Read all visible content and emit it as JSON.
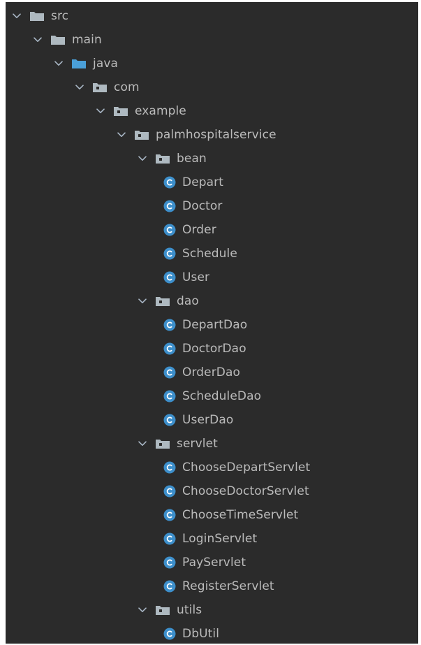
{
  "tree": {
    "nodes": [
      {
        "label": "src",
        "depth": 0,
        "kind": "folder",
        "expanded": true
      },
      {
        "label": "main",
        "depth": 1,
        "kind": "folder",
        "expanded": true
      },
      {
        "label": "java",
        "depth": 2,
        "kind": "source-root",
        "expanded": true
      },
      {
        "label": "com",
        "depth": 3,
        "kind": "package",
        "expanded": true
      },
      {
        "label": "example",
        "depth": 4,
        "kind": "package",
        "expanded": true
      },
      {
        "label": "palmhospitalservice",
        "depth": 5,
        "kind": "package",
        "expanded": true
      },
      {
        "label": "bean",
        "depth": 6,
        "kind": "package",
        "expanded": true
      },
      {
        "label": "Depart",
        "depth": 7,
        "kind": "class"
      },
      {
        "label": "Doctor",
        "depth": 7,
        "kind": "class"
      },
      {
        "label": "Order",
        "depth": 7,
        "kind": "class"
      },
      {
        "label": "Schedule",
        "depth": 7,
        "kind": "class"
      },
      {
        "label": "User",
        "depth": 7,
        "kind": "class"
      },
      {
        "label": "dao",
        "depth": 6,
        "kind": "package",
        "expanded": true
      },
      {
        "label": "DepartDao",
        "depth": 7,
        "kind": "class"
      },
      {
        "label": "DoctorDao",
        "depth": 7,
        "kind": "class"
      },
      {
        "label": "OrderDao",
        "depth": 7,
        "kind": "class"
      },
      {
        "label": "ScheduleDao",
        "depth": 7,
        "kind": "class"
      },
      {
        "label": "UserDao",
        "depth": 7,
        "kind": "class"
      },
      {
        "label": "servlet",
        "depth": 6,
        "kind": "package",
        "expanded": true
      },
      {
        "label": "ChooseDepartServlet",
        "depth": 7,
        "kind": "class"
      },
      {
        "label": "ChooseDoctorServlet",
        "depth": 7,
        "kind": "class"
      },
      {
        "label": "ChooseTimeServlet",
        "depth": 7,
        "kind": "class"
      },
      {
        "label": "LoginServlet",
        "depth": 7,
        "kind": "class"
      },
      {
        "label": "PayServlet",
        "depth": 7,
        "kind": "class"
      },
      {
        "label": "RegisterServlet",
        "depth": 7,
        "kind": "class"
      },
      {
        "label": "utils",
        "depth": 6,
        "kind": "package",
        "expanded": true
      },
      {
        "label": "DbUtil",
        "depth": 7,
        "kind": "class"
      }
    ]
  },
  "colors": {
    "background": "#2b2b2b",
    "text": "#bbbbbb",
    "arrow": "#a9b7c6",
    "folder": "#aeb9c0",
    "source_root": "#4a9fd8",
    "package_dot": "#2b2b2b",
    "class_circle": "#3d8fcb",
    "class_letter": "#ffffff"
  },
  "icons": {
    "expanded": "chevron-down-icon",
    "folder": "folder-icon",
    "source_root": "source-root-folder-icon",
    "package": "package-icon",
    "class": "java-class-icon"
  }
}
